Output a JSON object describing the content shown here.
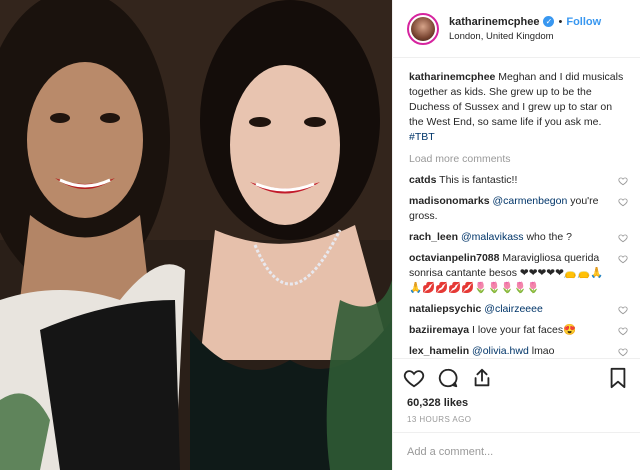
{
  "post": {
    "username": "katharinemcphee",
    "verified_glyph": "✓",
    "separator": "•",
    "follow_label": "Follow",
    "location": "London, United Kingdom"
  },
  "caption": {
    "username": "katharinemcphee",
    "text": " Meghan and I did musicals together as kids. She grew up to be the Duchess of Sussex and I grew up to star on the West End, so same life if you ask me. ",
    "hashtag": "#TBT"
  },
  "load_more_label": "Load more comments",
  "comments": [
    {
      "user": "catds",
      "mention": "",
      "text": " This is fantastic!!"
    },
    {
      "user": "madisonomarks",
      "mention": "@carmenbegon",
      "text": " you're gross."
    },
    {
      "user": "rach_leen",
      "mention": "@malavikass",
      "text": " who the ?"
    },
    {
      "user": "octavianpelin7088",
      "mention": "",
      "text": " Maravigliosa querida sonrisa cantante besos ❤❤❤❤❤👝👝🙏🙏💋💋💋💋🌷🌷🌷🌷🌷"
    },
    {
      "user": "nataliepsychic",
      "mention": "@clairzeeee",
      "text": ""
    },
    {
      "user": "baziiremaya",
      "mention": "",
      "text": " I love your fat faces😍"
    },
    {
      "user": "lex_hamelin",
      "mention": "@olivia.hwd",
      "text": " lmao"
    }
  ],
  "likes": "60,328 likes",
  "time": "13 HOURS AGO",
  "add_comment_placeholder": "Add a comment...",
  "icons": {
    "like": "heart-icon",
    "comment": "comment-icon",
    "share": "share-icon",
    "save": "bookmark-icon"
  }
}
